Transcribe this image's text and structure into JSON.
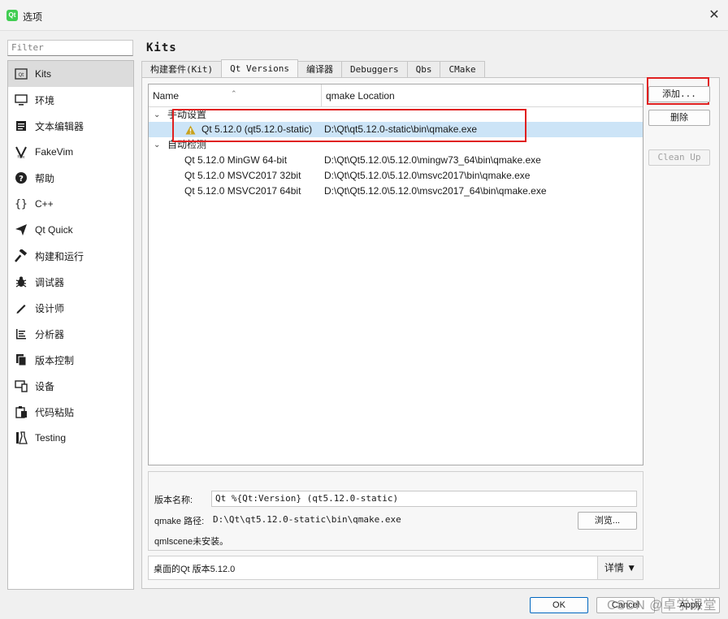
{
  "window": {
    "title": "选项",
    "app_icon_label": "Qt"
  },
  "filter": {
    "placeholder": "Filter"
  },
  "nav": {
    "items": [
      {
        "label": "Kits",
        "icon": "kits-icon"
      },
      {
        "label": "环境",
        "icon": "monitor-icon"
      },
      {
        "label": "文本编辑器",
        "icon": "text-editor-icon"
      },
      {
        "label": "FakeVim",
        "icon": "fakevim-icon"
      },
      {
        "label": "帮助",
        "icon": "help-icon"
      },
      {
        "label": "C++",
        "icon": "braces-icon"
      },
      {
        "label": "Qt Quick",
        "icon": "paper-plane-icon"
      },
      {
        "label": "构建和运行",
        "icon": "hammer-icon"
      },
      {
        "label": "调试器",
        "icon": "bug-icon"
      },
      {
        "label": "设计师",
        "icon": "pencil-icon"
      },
      {
        "label": "分析器",
        "icon": "analyzer-icon"
      },
      {
        "label": "版本控制",
        "icon": "version-control-icon"
      },
      {
        "label": "设备",
        "icon": "device-icon"
      },
      {
        "label": "代码粘贴",
        "icon": "paste-icon"
      },
      {
        "label": "Testing",
        "icon": "flask-icon"
      }
    ],
    "selected": "Kits"
  },
  "page": {
    "title": "Kits"
  },
  "tabs": [
    {
      "label": "构建套件(Kit)"
    },
    {
      "label": "Qt Versions"
    },
    {
      "label": "编译器"
    },
    {
      "label": "Debuggers"
    },
    {
      "label": "Qbs"
    },
    {
      "label": "CMake"
    }
  ],
  "tree": {
    "columns": {
      "name": "Name",
      "location": "qmake Location"
    },
    "groups": [
      {
        "label": "手动设置",
        "rows": [
          {
            "name": "Qt 5.12.0 (qt5.12.0-static)",
            "path": "D:\\Qt\\qt5.12.0-static\\bin\\qmake.exe",
            "warning": true
          }
        ]
      },
      {
        "label": "自动检测",
        "rows": [
          {
            "name": "Qt 5.12.0 MinGW 64-bit",
            "path": "D:\\Qt\\Qt5.12.0\\5.12.0\\mingw73_64\\bin\\qmake.exe"
          },
          {
            "name": "Qt 5.12.0 MSVC2017 32bit",
            "path": "D:\\Qt\\Qt5.12.0\\5.12.0\\msvc2017\\bin\\qmake.exe"
          },
          {
            "name": "Qt 5.12.0 MSVC2017 64bit",
            "path": "D:\\Qt\\Qt5.12.0\\5.12.0\\msvc2017_64\\bin\\qmake.exe"
          }
        ]
      }
    ]
  },
  "side_buttons": {
    "add": "添加...",
    "remove": "删除",
    "cleanup": "Clean Up"
  },
  "details": {
    "version_name_label": "版本名称:",
    "version_name_value": "Qt %{Qt:Version} (qt5.12.0-static)",
    "qmake_path_label": "qmake 路径:",
    "qmake_path_value": "D:\\Qt\\qt5.12.0-static\\bin\\qmake.exe",
    "browse": "浏览...",
    "qmlscene_note": "qmlscene未安装。"
  },
  "summary": {
    "text": "桌面的Qt 版本5.12.0",
    "details_button": "详情 ▼"
  },
  "dialog_buttons": {
    "ok": "OK",
    "cancel": "Cancel",
    "apply": "Apply"
  },
  "watermark": "CSDN @卓学课堂",
  "colors": {
    "selection": "#cce4f7",
    "highlight_box": "#e02020",
    "warning": "#c8a21e"
  }
}
